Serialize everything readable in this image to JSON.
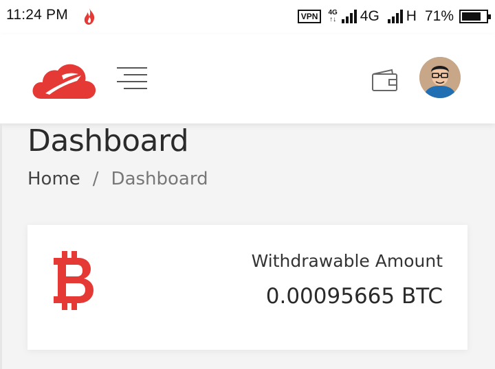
{
  "status_bar": {
    "time": "11:24 PM",
    "vpn": "VPN",
    "net_small_top": "4G",
    "net_small_bottom": "↑↓",
    "network1": "4G",
    "network2": "H",
    "battery": "71%",
    "battery_level": 0.71
  },
  "header": {
    "logo_icon": "cloud-logo-icon",
    "menu_icon": "hamburger-menu-icon",
    "wallet_icon": "wallet-icon",
    "avatar_icon": "user-avatar-icon"
  },
  "page": {
    "title": "Dashboard",
    "breadcrumb": {
      "home": "Home",
      "separator": "/",
      "current": "Dashboard"
    }
  },
  "card": {
    "icon": "bitcoin-icon",
    "label": "Withdrawable Amount",
    "value": "0.00095665 BTC"
  },
  "colors": {
    "brand_red": "#e53935",
    "text_dark": "#2b2b2b",
    "background": "#f4f4f4"
  }
}
